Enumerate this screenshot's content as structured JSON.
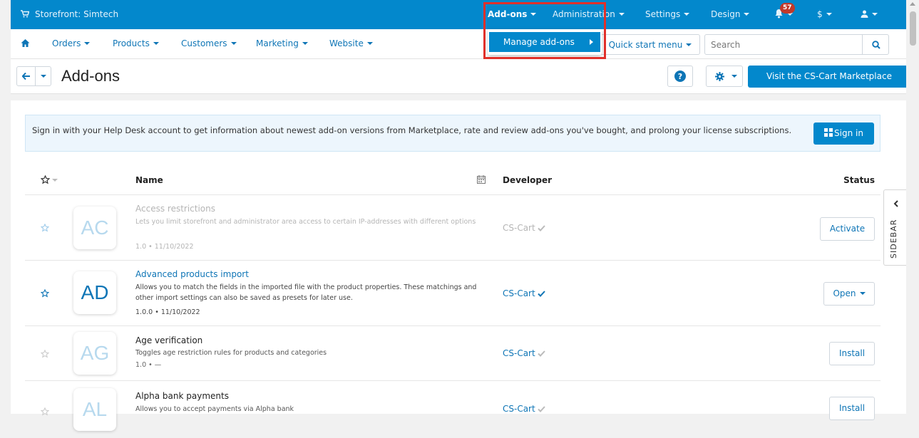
{
  "topbar": {
    "store": "Storefront: Simtech",
    "items": [
      {
        "label": "Add-ons"
      },
      {
        "label": "Administration"
      },
      {
        "label": "Settings"
      },
      {
        "label": "Design"
      }
    ],
    "notifications": "57",
    "currency": "$"
  },
  "mainnav": {
    "items": [
      {
        "label": "Orders"
      },
      {
        "label": "Products"
      },
      {
        "label": "Customers"
      },
      {
        "label": "Marketing"
      },
      {
        "label": "Website"
      }
    ],
    "quick_start": "Quick start menu",
    "search_placeholder": "Search"
  },
  "dropdown": {
    "item": "Manage add-ons"
  },
  "titlebar": {
    "title": "Add-ons",
    "marketplace": "Visit the CS-Cart Marketplace"
  },
  "alert": {
    "text": "Sign in with your Help Desk account to get information about newest add-on versions from Marketplace, rate and review add-ons you've bought, and prolong your license subscriptions.",
    "button": "Sign in"
  },
  "table": {
    "headers": {
      "name": "Name",
      "developer": "Developer",
      "status": "Status"
    },
    "rows": [
      {
        "logo": "AC",
        "name": "Access restrictions",
        "desc": "Lets you limit storefront and administrator area access to certain IP-addresses with different options",
        "meta": "1.0 • 11/10/2022",
        "developer": "CS-Cart",
        "action": "Activate"
      },
      {
        "logo": "AD",
        "name": "Advanced products import",
        "desc": "Allows you to match the fields in the imported file with the product properties. These matchings and other import settings can also be saved as presets for later use.",
        "meta": "1.0.0 • 11/10/2022",
        "developer": "CS-Cart",
        "action": "Open"
      },
      {
        "logo": "AG",
        "name": "Age verification",
        "desc": "Toggles age restriction rules for products and categories",
        "meta": "1.0 • —",
        "developer": "CS-Cart",
        "action": "Install"
      },
      {
        "logo": "AL",
        "name": "Alpha bank payments",
        "desc": "Allows you to accept payments via Alpha bank",
        "meta": "",
        "developer": "CS-Cart",
        "action": "Install"
      }
    ]
  },
  "sidebar": {
    "label": "SIDEBAR"
  },
  "colors": {
    "primary": "#0388cc",
    "link": "#0e75b6",
    "highlight": "#e0302a",
    "badge": "#c0392b"
  }
}
